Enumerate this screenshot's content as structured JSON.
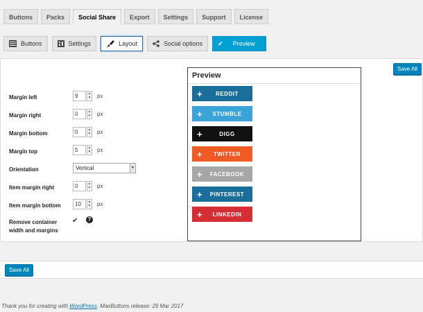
{
  "main_tabs": [
    "Buttons",
    "Packs",
    "Social Share",
    "Export",
    "Settings",
    "Support",
    "License"
  ],
  "sub_tabs": {
    "buttons": "Buttons",
    "settings": "Settings",
    "layout": "Layout",
    "social_options": "Social options",
    "preview": "Preview"
  },
  "save_all_top": "Save All",
  "save_all_bottom": "Save All",
  "form": {
    "margin_left": {
      "label": "Margin left",
      "value": "9",
      "unit": "px"
    },
    "margin_right": {
      "label": "Margin right",
      "value": "0",
      "unit": "px"
    },
    "margin_bottom": {
      "label": "Margin bottom",
      "value": "0",
      "unit": "px"
    },
    "margin_top": {
      "label": "Margin top",
      "value": "5",
      "unit": "px"
    },
    "orientation": {
      "label": "Orientation",
      "value": "Vertical"
    },
    "item_margin_right": {
      "label": "Item margin right",
      "value": "0",
      "unit": "px"
    },
    "item_margin_bottom": {
      "label": "Item margin bottom",
      "value": "10",
      "unit": "px"
    },
    "remove_container": {
      "label_line1": "Remove container",
      "label_line2": "width and margins",
      "checked": "✔",
      "help": "?"
    }
  },
  "preview": {
    "title": "Preview",
    "buttons": [
      {
        "label": "REDDIT",
        "color": "#1a6e9c"
      },
      {
        "label": "STUMBLE",
        "color": "#3aa3d8"
      },
      {
        "label": "DIGG",
        "color": "#111111"
      },
      {
        "label": "TWITTER",
        "color": "#f15a24"
      },
      {
        "label": "FACEBOOK",
        "color": "#a6a6a6"
      },
      {
        "label": "PINTEREST",
        "color": "#1a6e9c"
      },
      {
        "label": "LINKEDIN",
        "color": "#d62e35"
      }
    ]
  },
  "footer": {
    "prefix": "Thank you for creating with ",
    "link": "WordPress",
    "suffix": ". MaxButtons release: 29 Mar 2017"
  }
}
